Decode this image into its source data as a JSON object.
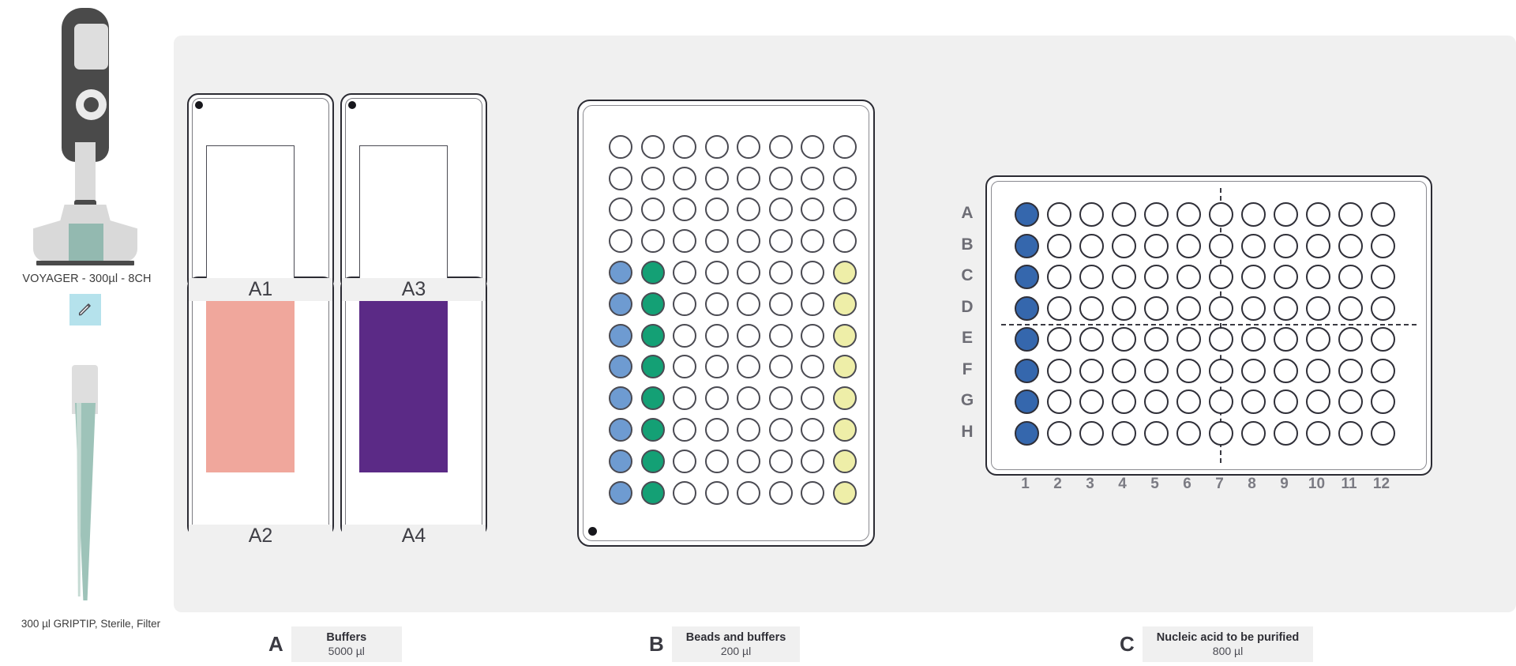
{
  "instrument": {
    "pipette_label": "VOYAGER - 300µl - 8CH",
    "tip_label": "300 µl GRIPTIP,  Sterile, Filter",
    "edit_icon": "pencil-icon",
    "edit_chip_color": "#b5e2ec"
  },
  "colors": {
    "deck_background": "#f0f0f0",
    "labware_border": "#2b2b33",
    "reservoir_pink": "#f0a79c",
    "reservoir_purple": "#5b2a86",
    "well_blue_light": "#6e9bd1",
    "well_green": "#14a075",
    "well_yellow": "#eeeea8",
    "well_blue_dark": "#3567ad",
    "well_empty": "#ffffff"
  },
  "positions": {
    "A": {
      "letter": "A",
      "name": "Buffers",
      "volume": "5000 µl",
      "labware": "4-position reservoir block",
      "reservoirs": [
        {
          "id": "A1",
          "label": "A1",
          "fill": null,
          "fill_name": "empty"
        },
        {
          "id": "A3",
          "label": "A3",
          "fill": null,
          "fill_name": "empty"
        },
        {
          "id": "A2",
          "label": "A2",
          "fill": "#f0a79c",
          "fill_name": "pink-buffer"
        },
        {
          "id": "A4",
          "label": "A4",
          "fill": "#5b2a86",
          "fill_name": "purple-buffer"
        }
      ]
    },
    "B": {
      "letter": "B",
      "name": "Beads and buffers",
      "volume": "200 µl",
      "labware": "deep-well reservoir plate",
      "rows": 12,
      "columns": 8,
      "column_fills": [
        "#6e9bd1",
        "#14a075",
        null,
        null,
        null,
        null,
        null,
        "#eeeea8"
      ],
      "filled_row_start": 5,
      "filled_row_end": 12
    },
    "C": {
      "letter": "C",
      "name": "Nucleic acid to be purified",
      "volume": "800 µl",
      "labware": "96-well microplate",
      "row_labels": [
        "A",
        "B",
        "C",
        "D",
        "E",
        "F",
        "G",
        "H"
      ],
      "column_labels": [
        "1",
        "2",
        "3",
        "4",
        "5",
        "6",
        "7",
        "8",
        "9",
        "10",
        "11",
        "12"
      ],
      "filled_column": 1,
      "filled_color": "#3567ad"
    }
  }
}
